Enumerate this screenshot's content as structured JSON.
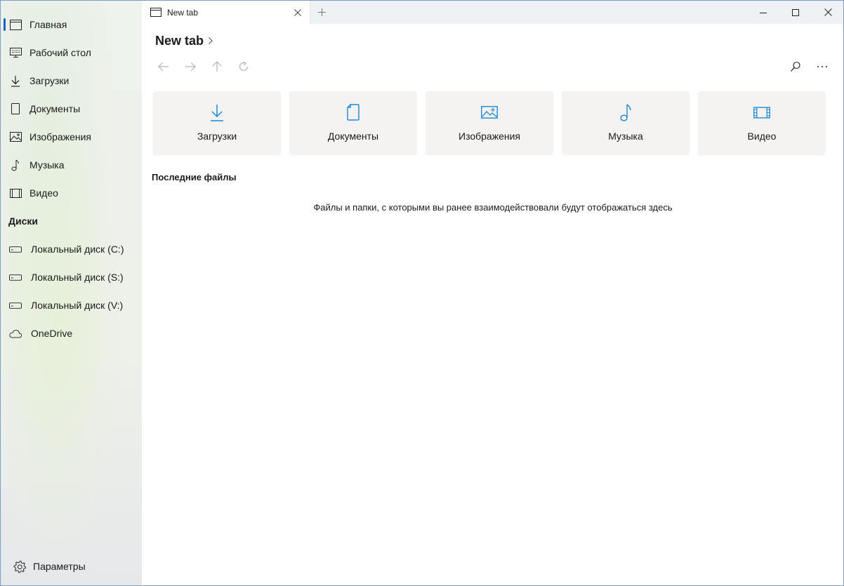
{
  "sidebar": {
    "items": [
      {
        "label": "Главная",
        "icon": "home-icon"
      },
      {
        "label": "Рабочий стол",
        "icon": "desktop-icon"
      },
      {
        "label": "Загрузки",
        "icon": "downloads-icon"
      },
      {
        "label": "Документы",
        "icon": "documents-icon"
      },
      {
        "label": "Изображения",
        "icon": "pictures-icon"
      },
      {
        "label": "Музыка",
        "icon": "music-icon"
      },
      {
        "label": "Видео",
        "icon": "video-icon"
      }
    ],
    "drives_header": "Диски",
    "drives": [
      {
        "label": "Локальный диск (C:)",
        "icon": "drive-icon"
      },
      {
        "label": "Локальный диск (S:)",
        "icon": "drive-icon"
      },
      {
        "label": "Локальный диск (V:)",
        "icon": "drive-icon"
      },
      {
        "label": "OneDrive",
        "icon": "cloud-icon"
      }
    ],
    "settings_label": "Параметры"
  },
  "tabs": [
    {
      "label": "New tab",
      "active": true
    }
  ],
  "main": {
    "title": "New tab",
    "cards": [
      {
        "label": "Загрузки",
        "icon": "download-arrow-icon"
      },
      {
        "label": "Документы",
        "icon": "document-icon"
      },
      {
        "label": "Изображения",
        "icon": "image-icon"
      },
      {
        "label": "Музыка",
        "icon": "music-note-icon"
      },
      {
        "label": "Видео",
        "icon": "film-icon"
      }
    ],
    "recent_title": "Последние файлы",
    "empty_message": "Файлы и папки, с которыми вы ранее взаимодействовали будут отображаться здесь"
  },
  "colors": {
    "accent": "#0a63c9",
    "icon_blue": "#1e88d6",
    "card_bg": "#f4f3f1"
  }
}
